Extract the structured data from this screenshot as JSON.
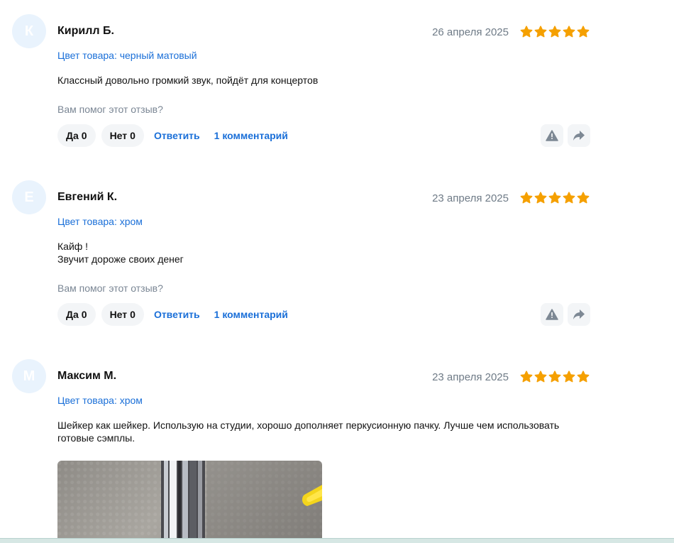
{
  "reviews": [
    {
      "initial": "К",
      "author": "Кирилл Б.",
      "date": "26 апреля 2025",
      "rating": 5,
      "color_label": "Цвет товара: черный матовый",
      "text": "Классный довольно громкий звук, пойдёт для концертов",
      "helpful_q": "Вам помог этот отзыв?",
      "yes_label": "Да",
      "yes_count": "0",
      "no_label": "Нет",
      "no_count": "0",
      "reply_label": "Ответить",
      "comments_label": "1 комментарий"
    },
    {
      "initial": "Е",
      "author": "Евгений К.",
      "date": "23 апреля 2025",
      "rating": 5,
      "color_label": "Цвет товара: хром",
      "text": "Кайф !\nЗвучит дороже своих денег",
      "helpful_q": "Вам помог этот отзыв?",
      "yes_label": "Да",
      "yes_count": "0",
      "no_label": "Нет",
      "no_count": "0",
      "reply_label": "Ответить",
      "comments_label": "1 комментарий"
    },
    {
      "initial": "М",
      "author": "Максим М.",
      "date": "23 апреля 2025",
      "rating": 5,
      "color_label": "Цвет товара: хром",
      "text": "Шейкер как шейкер. Использую на студии, хорошо дополняет перкусионную пачку. Лучше чем использовать готовые сэмплы."
    }
  ],
  "colors": {
    "star": "#f5a000",
    "link": "#1a6fd8",
    "avatar_bg": "#e9f3fd"
  },
  "icons": {
    "report": "warning-triangle-icon",
    "share": "share-arrow-icon"
  }
}
